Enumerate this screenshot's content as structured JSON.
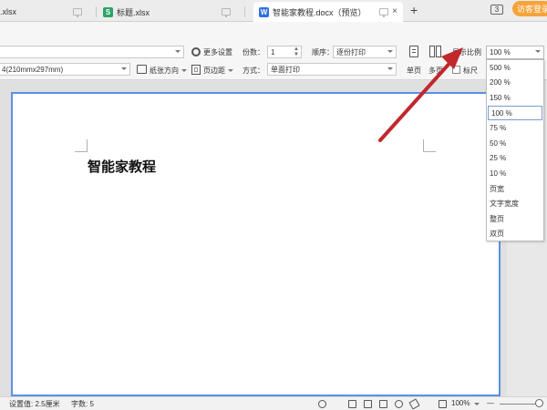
{
  "tabs": [
    {
      "label": ".xlsx"
    },
    {
      "label": "标题.xlsx",
      "icon": "S"
    },
    {
      "label": "智能家教程.docx（预览）",
      "icon": "W",
      "close": "×"
    }
  ],
  "tabbar": {
    "new_tab": "+",
    "badge": "3",
    "visitor_login": "访客登录"
  },
  "toolbar": {
    "more_settings": "更多设置",
    "copies_label": "份数：",
    "copies_value": "1",
    "order_label": "顺序：",
    "order_value": "逐份打印",
    "paper_size_value": "4(210mmx297mm)",
    "paper_orientation": "纸张方向",
    "margins": "页边距",
    "method_label": "方式：",
    "method_value": "单面打印",
    "single_page": "单页",
    "multi_page": "多页",
    "zoom_ratio_label": "显示比例",
    "ruler": "标尺",
    "zoom_value": "100 %"
  },
  "zoom_options": [
    "500 %",
    "200 %",
    "150 %",
    "100 %",
    "75 %",
    "50 %",
    "25 %",
    "10 %",
    "页宽",
    "文字宽度",
    "整页",
    "双页"
  ],
  "zoom_selected_index": 3,
  "document": {
    "title": "智能家教程"
  },
  "status": {
    "setting": "设置值: 2.5厘米",
    "word_count": "字数: 5",
    "zoom": "100%",
    "minus": "—"
  },
  "colors": {
    "accent": "#5c8fe6",
    "visitor_button": "#f5a43a",
    "arrow": "#c0282d"
  }
}
